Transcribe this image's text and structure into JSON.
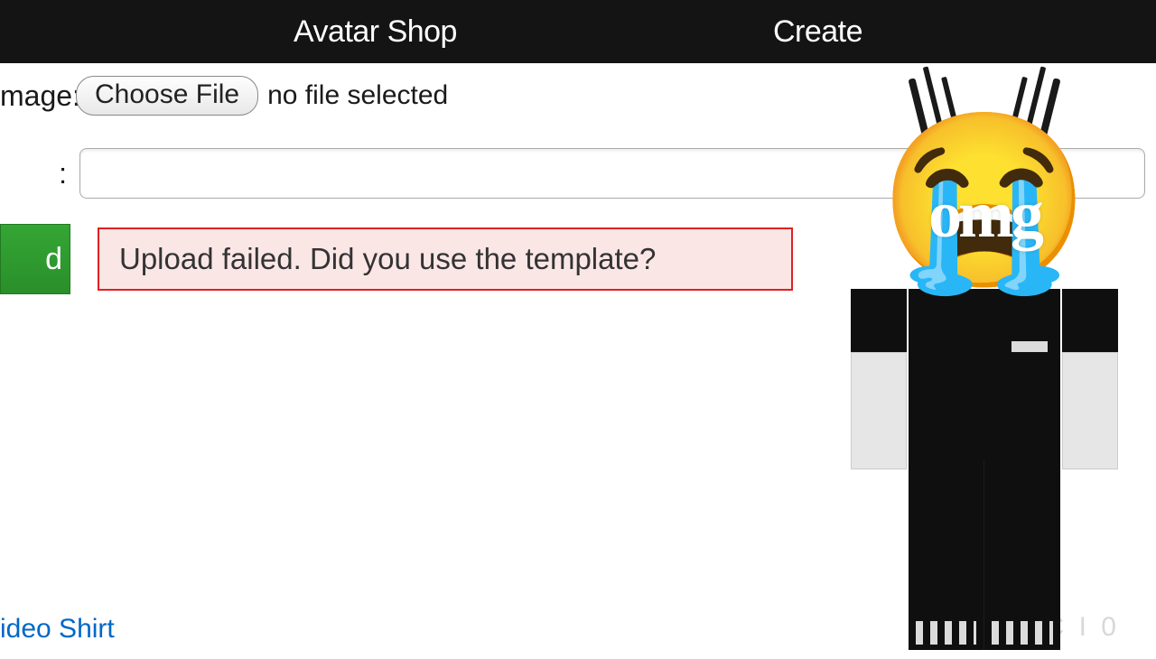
{
  "header": {
    "tab_avatar_shop": "Avatar Shop",
    "tab_create": "Create"
  },
  "form": {
    "label_image": "mage:",
    "choose_file_btn": "Choose File",
    "file_status": "no file selected",
    "label_name": ":",
    "name_input_value": "",
    "upload_button_fragment": "d",
    "error_message": "Upload failed. Did you use the template?"
  },
  "overlay": {
    "omg_text": "omg",
    "emoji": "😭"
  },
  "footer": {
    "link_fragment": "ideo Shirt",
    "right_fragment": "T  I C I     0"
  }
}
